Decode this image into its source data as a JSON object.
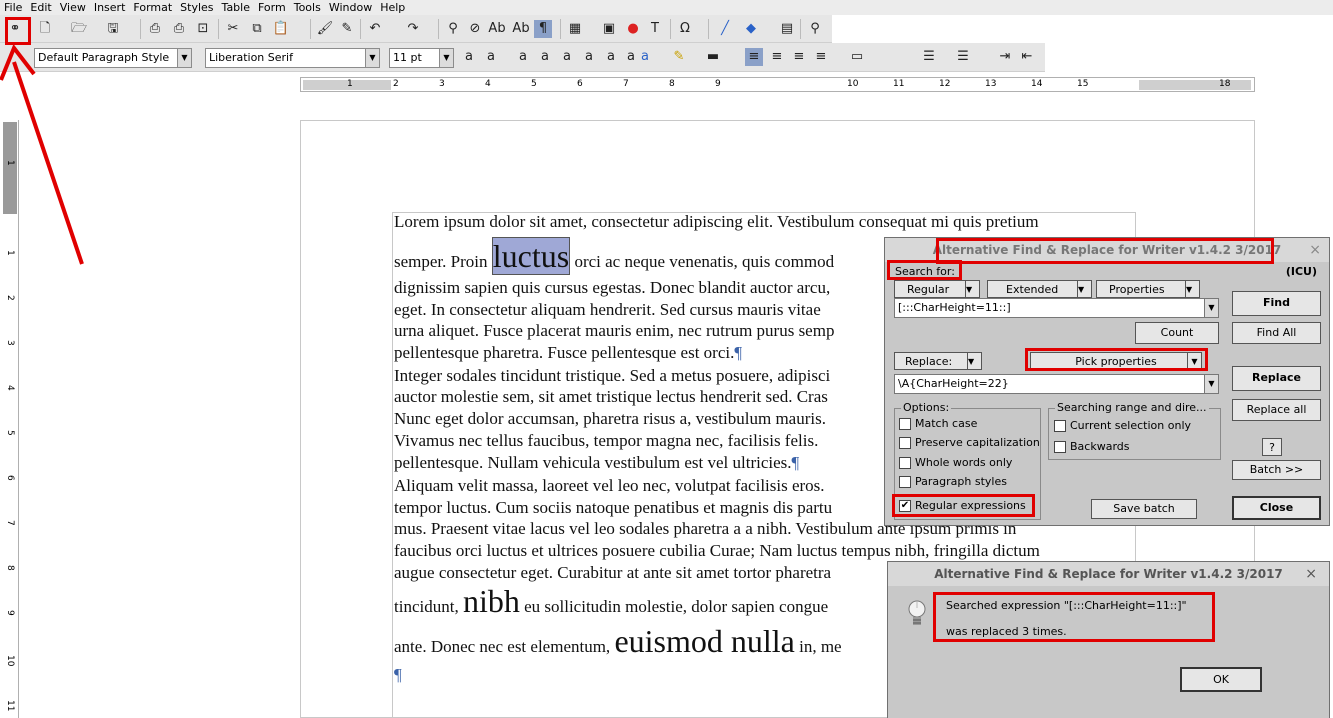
{
  "menu": [
    "File",
    "Edit",
    "View",
    "Insert",
    "Format",
    "Styles",
    "Table",
    "Form",
    "Tools",
    "Window",
    "Help"
  ],
  "toolbar": {
    "icons": [
      "binoculars-icon",
      "new-document-icon",
      "open-icon",
      "save-icon",
      "export-pdf-icon",
      "print-icon",
      "print-preview-icon",
      "cut-icon",
      "copy-icon",
      "paste-icon",
      "clone-formatting-icon",
      "clear-formatting-icon",
      "undo-icon",
      "redo-icon",
      "find-icon",
      "no-icon",
      "spelling-icon",
      "autospell-icon",
      "formatting-marks-icon",
      "table-icon",
      "image-icon",
      "chart-icon",
      "text-box-icon",
      "special-character-icon",
      "line-icon",
      "shapes-icon",
      "form-icon",
      "zoom-icon"
    ],
    "paragraph_style": "Default Paragraph Style",
    "font_name": "Liberation Serif",
    "font_size": "11 pt"
  },
  "ruler": {
    "h_numbers": [
      "1",
      "1",
      "2",
      "3",
      "4",
      "5",
      "6",
      "7",
      "8",
      "9",
      "10",
      "11",
      "12",
      "13",
      "14",
      "15",
      "18"
    ],
    "v_numbers": [
      "1",
      "1",
      "2",
      "3",
      "4",
      "5",
      "6",
      "7",
      "8",
      "9",
      "10",
      "11"
    ]
  },
  "document": {
    "lines": [
      {
        "pre": "Lorem ipsum dolor sit amet, consectetur adipiscing elit. Vestibulum consequat mi quis pretium",
        "big": "",
        "post": ""
      },
      {
        "pre": "semper. Proin ",
        "big": "luctus",
        "post": " orci ac neque venenatis, quis commod"
      },
      {
        "pre": "dignissim sapien quis cursus egestas. Donec blandit auctor arcu,",
        "big": "",
        "post": ""
      },
      {
        "pre": "eget. In consectetur aliquam hendrerit. Sed cursus mauris vitae",
        "big": "",
        "post": ""
      },
      {
        "pre": "urna aliquet. Fusce placerat mauris enim, nec rutrum purus semp",
        "big": "",
        "post": ""
      },
      {
        "pre": "pellentesque pharetra. Fusce pellentesque est orci.",
        "big": "",
        "post": "¶"
      },
      {
        "pre": "Integer sodales tincidunt tristique. Sed a metus posuere, adipisci",
        "big": "",
        "post": ""
      },
      {
        "pre": "auctor molestie sem, sit amet tristique lectus hendrerit sed. Cras",
        "big": "",
        "post": ""
      },
      {
        "pre": "Nunc eget dolor accumsan, pharetra risus a, vestibulum mauris.",
        "big": "",
        "post": ""
      },
      {
        "pre": "Vivamus nec tellus faucibus, tempor magna nec, facilisis felis.",
        "big": "",
        "post": ""
      },
      {
        "pre": "pellentesque. Nullam vehicula vestibulum est vel ultricies.",
        "big": "",
        "post": "¶"
      },
      {
        "pre": "Aliquam velit massa, laoreet vel leo nec, volutpat facilisis eros.",
        "big": "",
        "post": ""
      },
      {
        "pre": "tempor luctus. Cum sociis natoque penatibus et magnis dis partu",
        "big": "",
        "post": ""
      },
      {
        "pre": "mus. Praesent vitae lacus vel leo sodales pharetra a a nibh. Vestibulum ante ipsum primis in",
        "big": "",
        "post": ""
      },
      {
        "pre": "faucibus orci luctus et ultrices posuere cubilia Curae; Nam luctus tempus nibh, fringilla dictum",
        "big": "",
        "post": ""
      },
      {
        "pre": "augue consectetur eget. Curabitur at ante sit amet tortor pharetra",
        "big": "",
        "post": ""
      },
      {
        "pre": "tincidunt, ",
        "big": "nibh",
        "post": " eu sollicitudin molestie, dolor sapien congue"
      },
      {
        "pre": "ante. Donec nec est elementum, ",
        "big": "euismod nulla",
        "post": " in, me"
      },
      {
        "pre": "",
        "big": "",
        "post": "¶"
      }
    ]
  },
  "find_dialog": {
    "title": "Alternative Find & Replace for Writer  v1.4.2  3/2017",
    "close": "×",
    "search_for_label": "Search for:",
    "icu": "(ICU)",
    "mode_regular": "Regular",
    "mode_extended": "Extended",
    "mode_properties": "Properties",
    "search_value": "[:::CharHeight=11::]",
    "find": "Find",
    "find_all": "Find All",
    "count": "Count",
    "replace_label": "Replace:",
    "pick_properties": "Pick properties",
    "replace_value": "\\A{CharHeight=22}",
    "replace": "Replace",
    "replace_all": "Replace all",
    "options_label": "Options:",
    "options": [
      {
        "label": "Match case",
        "checked": false
      },
      {
        "label": "Preserve capitalization",
        "checked": false
      },
      {
        "label": "Whole words only",
        "checked": false
      },
      {
        "label": "Paragraph styles",
        "checked": false
      },
      {
        "label": "Regular expressions",
        "checked": true
      }
    ],
    "range_label": "Searching range and dire...",
    "range_options": [
      {
        "label": "Current selection only",
        "checked": false
      },
      {
        "label": "Backwards",
        "checked": false
      }
    ],
    "help": "?",
    "batch": "Batch >>",
    "save_batch": "Save batch",
    "close_button": "Close"
  },
  "result_dialog": {
    "title": "Alternative Find & Replace for Writer  v1.4.2  3/2017",
    "close": "×",
    "line1": "Searched expression    \"[:::CharHeight=11::]\"",
    "line2": "was replaced  3  times.",
    "ok": "OK"
  },
  "colors": {
    "highlight": "#e00000",
    "selection": "#9fa8d6",
    "pilcrow": "#3b62a8"
  }
}
